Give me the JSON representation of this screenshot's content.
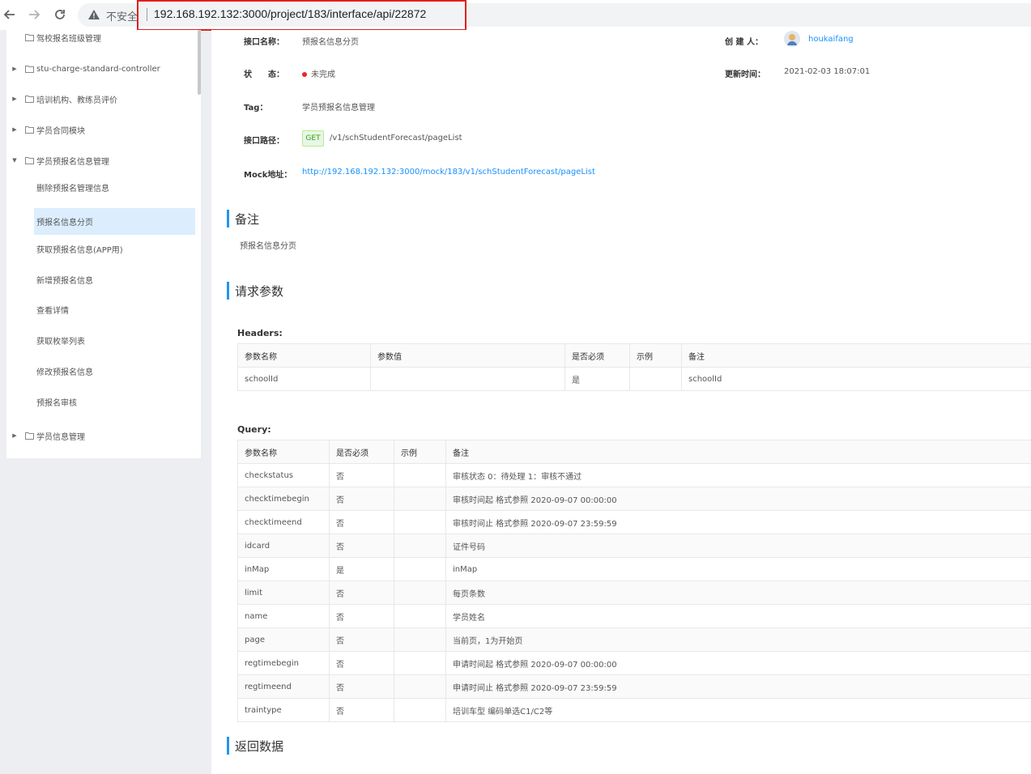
{
  "browser": {
    "insecure_label": "不安全",
    "url": "192.168.192.132:3000/project/183/interface/api/22872"
  },
  "sidebar": {
    "folders_top": [
      {
        "label": "驾校报名班级管理"
      },
      {
        "label": "stu-charge-standard-controller"
      },
      {
        "label": "培训机构、教练员评价"
      },
      {
        "label": "学员合同模块"
      },
      {
        "label": "学员预报名信息管理"
      }
    ],
    "leaves": [
      {
        "label": "删除预报名管理信息"
      },
      {
        "label": "预报名信息分页"
      },
      {
        "label": "获取预报名信息(APP用)"
      },
      {
        "label": "新增预报名信息"
      },
      {
        "label": "查看详情"
      },
      {
        "label": "获取枚举列表"
      },
      {
        "label": "修改预报名信息"
      },
      {
        "label": "预报名审核"
      }
    ],
    "folder_bottom": {
      "label": "学员信息管理"
    }
  },
  "info": {
    "name_label": "接口名称：",
    "name_value": "预报名信息分页",
    "creator_label": "创 建 人：",
    "creator_value": "houkaifang",
    "status_label": "状　　态：",
    "status_value": "未完成",
    "updated_label": "更新时间：",
    "updated_value": "2021-02-03 18:07:01",
    "tag_label": "Tag：",
    "tag_value": "学员预报名信息管理",
    "path_label": "接口路径：",
    "method": "GET",
    "path_value": "/v1/schStudentForecast/pageList",
    "mock_label": "Mock地址：",
    "mock_value": "http://192.168.192.132:3000/mock/183/v1/schStudentForecast/pageList"
  },
  "remark": {
    "title": "备注",
    "text": "预报名信息分页"
  },
  "request": {
    "title": "请求参数",
    "headers_title": "Headers:",
    "headers_columns": [
      "参数名称",
      "参数值",
      "是否必须",
      "示例",
      "备注"
    ],
    "headers_rows": [
      [
        "schoolId",
        "",
        "是",
        "",
        "schoolId"
      ]
    ],
    "query_title": "Query:",
    "query_columns": [
      "参数名称",
      "是否必须",
      "示例",
      "备注"
    ],
    "query_rows": [
      [
        "checkstatus",
        "否",
        "",
        "审核状态  0：待处理  1：审核不通过"
      ],
      [
        "checktimebegin",
        "否",
        "",
        "审核时间起 格式参照 2020-09-07 00:00:00"
      ],
      [
        "checktimeend",
        "否",
        "",
        "审核时间止 格式参照 2020-09-07 23:59:59"
      ],
      [
        "idcard",
        "否",
        "",
        "证件号码"
      ],
      [
        "inMap",
        "是",
        "",
        "inMap"
      ],
      [
        "limit",
        "否",
        "",
        "每页条数"
      ],
      [
        "name",
        "否",
        "",
        "学员姓名"
      ],
      [
        "page",
        "否",
        "",
        "当前页，1为开始页"
      ],
      [
        "regtimebegin",
        "否",
        "",
        "申请时间起 格式参照 2020-09-07 00:00:00"
      ],
      [
        "regtimeend",
        "否",
        "",
        "申请时间止 格式参照 2020-09-07 23:59:59"
      ],
      [
        "traintype",
        "否",
        "",
        "培训车型  编码单选C1/C2等"
      ]
    ]
  },
  "response": {
    "title": "返回数据"
  },
  "colors": {
    "accent": "#2395f1",
    "link": "#1890ff",
    "status_red": "#f5222d",
    "url_highlight": "#e02020",
    "active_item": "#dceefe"
  },
  "icons": [
    "back-arrow-icon",
    "forward-arrow-icon",
    "reload-icon",
    "warning-icon",
    "folder-icon",
    "caret-right-icon",
    "caret-down-icon"
  ]
}
